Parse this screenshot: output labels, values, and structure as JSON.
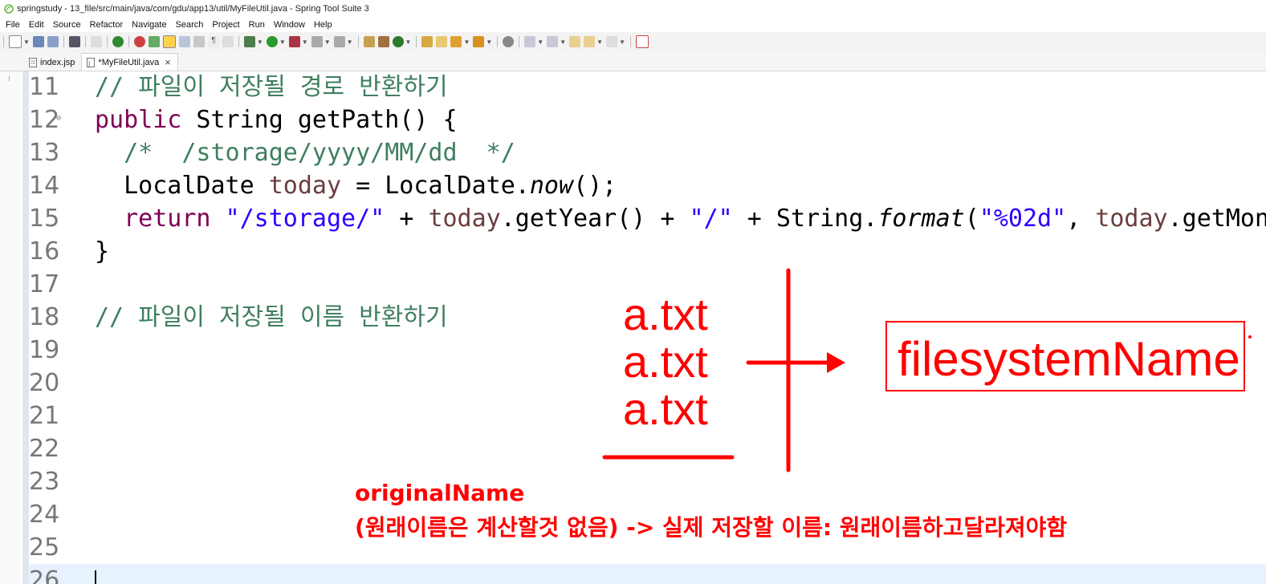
{
  "window": {
    "title": "springstudy - 13_file/src/main/java/com/gdu/app13/util/MyFileUtil.java - Spring Tool Suite 3"
  },
  "menu": [
    "File",
    "Edit",
    "Source",
    "Refactor",
    "Navigate",
    "Search",
    "Project",
    "Run",
    "Window",
    "Help"
  ],
  "tabs": [
    {
      "label": "index.jsp",
      "active": false
    },
    {
      "label": "*MyFileUtil.java",
      "active": true
    }
  ],
  "editor": {
    "lines": [
      {
        "n": "11",
        "segments": [
          {
            "t": "// 파일이 저장될 경로 반환하기",
            "c": "cm"
          }
        ]
      },
      {
        "n": "12",
        "fold": "⊖",
        "segments": [
          {
            "t": "public",
            "c": "kw"
          },
          {
            "t": " String getPath() {",
            "c": ""
          }
        ]
      },
      {
        "n": "13",
        "segments": [
          {
            "t": "  /*  /storage/yyyy/MM/dd  */",
            "c": "cm"
          }
        ]
      },
      {
        "n": "14",
        "segments": [
          {
            "t": "  LocalDate ",
            "c": ""
          },
          {
            "t": "today",
            "c": "var"
          },
          {
            "t": " = LocalDate.",
            "c": ""
          },
          {
            "t": "now",
            "c": "it"
          },
          {
            "t": "();",
            "c": ""
          }
        ]
      },
      {
        "n": "15",
        "segments": [
          {
            "t": "  ",
            "c": ""
          },
          {
            "t": "return",
            "c": "kw"
          },
          {
            "t": " ",
            "c": ""
          },
          {
            "t": "\"/storage/\"",
            "c": "st"
          },
          {
            "t": " + ",
            "c": ""
          },
          {
            "t": "today",
            "c": "var"
          },
          {
            "t": ".getYear() + ",
            "c": ""
          },
          {
            "t": "\"/\"",
            "c": "st"
          },
          {
            "t": " + String.",
            "c": ""
          },
          {
            "t": "format",
            "c": "it"
          },
          {
            "t": "(",
            "c": ""
          },
          {
            "t": "\"%02d\"",
            "c": "st"
          },
          {
            "t": ", ",
            "c": ""
          },
          {
            "t": "today",
            "c": "var"
          },
          {
            "t": ".getMont",
            "c": ""
          }
        ]
      },
      {
        "n": "16",
        "segments": [
          {
            "t": "}",
            "c": ""
          }
        ]
      },
      {
        "n": "17",
        "segments": []
      },
      {
        "n": "18",
        "segments": [
          {
            "t": "// 파일이 저장될 이름 반환하기",
            "c": "cm"
          }
        ]
      },
      {
        "n": "19",
        "segments": []
      },
      {
        "n": "20",
        "segments": []
      },
      {
        "n": "21",
        "segments": []
      },
      {
        "n": "22",
        "segments": []
      },
      {
        "n": "23",
        "segments": []
      },
      {
        "n": "24",
        "segments": []
      },
      {
        "n": "25",
        "segments": []
      },
      {
        "n": "26",
        "segments": [],
        "current": true
      }
    ]
  },
  "annotations": {
    "original_files": [
      "a.txt",
      "a.txt",
      "a.txt"
    ],
    "target_label": "filesystemName",
    "original_name_label": "originalName",
    "description": "(원래이름은 계산할것 없음) -> 실제 저장할 이름: 원래이름하고달라져야함",
    "color": "#ff0000"
  },
  "colors": {
    "keyword": "#7f0055",
    "comment": "#3f7f5f",
    "string": "#2a00ff",
    "variable": "#6a3e3e"
  }
}
